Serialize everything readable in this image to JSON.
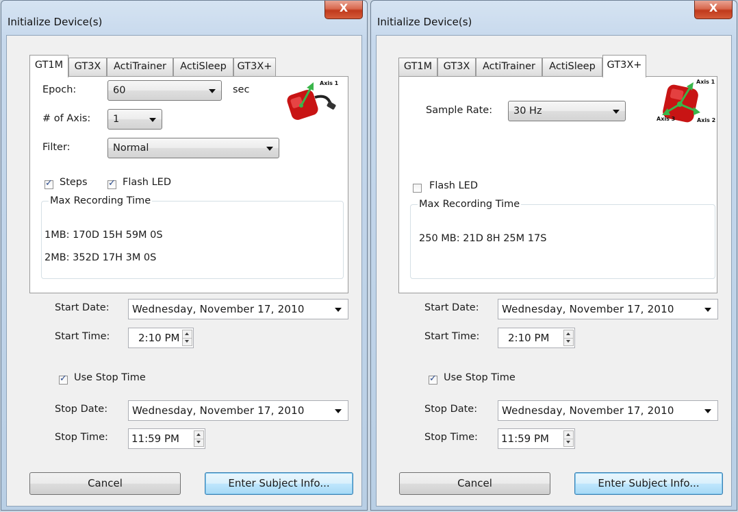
{
  "left_dialog": {
    "title": "Initialize Device(s)",
    "close_label": "X",
    "tabs": [
      {
        "label": "GT1M",
        "active": true
      },
      {
        "label": "GT3X",
        "active": false
      },
      {
        "label": "ActiTrainer",
        "active": false
      },
      {
        "label": "ActiSleep",
        "active": false
      },
      {
        "label": "GT3X+",
        "active": false
      }
    ],
    "epoch": {
      "label": "Epoch:",
      "value": "60",
      "unit": "sec"
    },
    "axis": {
      "label": "# of Axis:",
      "value": "1"
    },
    "filter": {
      "label": "Filter:",
      "value": "Normal"
    },
    "steps": {
      "label": "Steps",
      "checked": true
    },
    "flash_led": {
      "label": "Flash LED",
      "checked": true
    },
    "device_image": {
      "icon": "gt1m-device-icon",
      "axis1_label": "Axis 1",
      "color": "#d11a1a"
    },
    "max_recording": {
      "legend": "Max Recording Time",
      "lines": [
        "1MB: 170D 15H 59M 0S",
        "2MB: 352D 17H 3M 0S"
      ]
    },
    "start_date": {
      "label": "Start Date:",
      "value": "Wednesday, November 17, 2010"
    },
    "start_time": {
      "label": "Start Time:",
      "value": "2:10 PM"
    },
    "use_stop_time": {
      "label": "Use Stop Time",
      "checked": true
    },
    "stop_date": {
      "label": "Stop Date:",
      "value": "Wednesday, November 17, 2010"
    },
    "stop_time": {
      "label": "Stop Time:",
      "value": "11:59 PM"
    },
    "buttons": {
      "cancel": "Cancel",
      "enter": "Enter Subject Info..."
    }
  },
  "right_dialog": {
    "title": "Initialize Device(s)",
    "close_label": "X",
    "tabs": [
      {
        "label": "GT1M",
        "active": false
      },
      {
        "label": "GT3X",
        "active": false
      },
      {
        "label": "ActiTrainer",
        "active": false
      },
      {
        "label": "ActiSleep",
        "active": false
      },
      {
        "label": "GT3X+",
        "active": true
      }
    ],
    "sample_rate": {
      "label": "Sample Rate:",
      "value": "30 Hz"
    },
    "flash_led": {
      "label": "Flash LED",
      "checked": false
    },
    "device_image": {
      "icon": "gt3x-plus-device-icon",
      "axis1_label": "Axis 1",
      "axis2_label": "Axis 2",
      "axis3_label": "Axis 3",
      "color": "#d11a1a"
    },
    "max_recording": {
      "legend": "Max Recording Time",
      "lines": [
        "250 MB: 21D 8H 25M 17S"
      ]
    },
    "start_date": {
      "label": "Start Date:",
      "value": "Wednesday, November 17, 2010"
    },
    "start_time": {
      "label": "Start Time:",
      "value": "2:10 PM"
    },
    "use_stop_time": {
      "label": "Use Stop Time",
      "checked": true
    },
    "stop_date": {
      "label": "Stop Date:",
      "value": "Wednesday, November 17, 2010"
    },
    "stop_time": {
      "label": "Stop Time:",
      "value": "11:59 PM"
    },
    "buttons": {
      "cancel": "Cancel",
      "enter": "Enter Subject Info..."
    }
  },
  "colors": {
    "accent": "#3c7fb1",
    "close_button": "#c03a1c",
    "device": "#d11a1a",
    "axis_arrow": "#3ab54a"
  }
}
